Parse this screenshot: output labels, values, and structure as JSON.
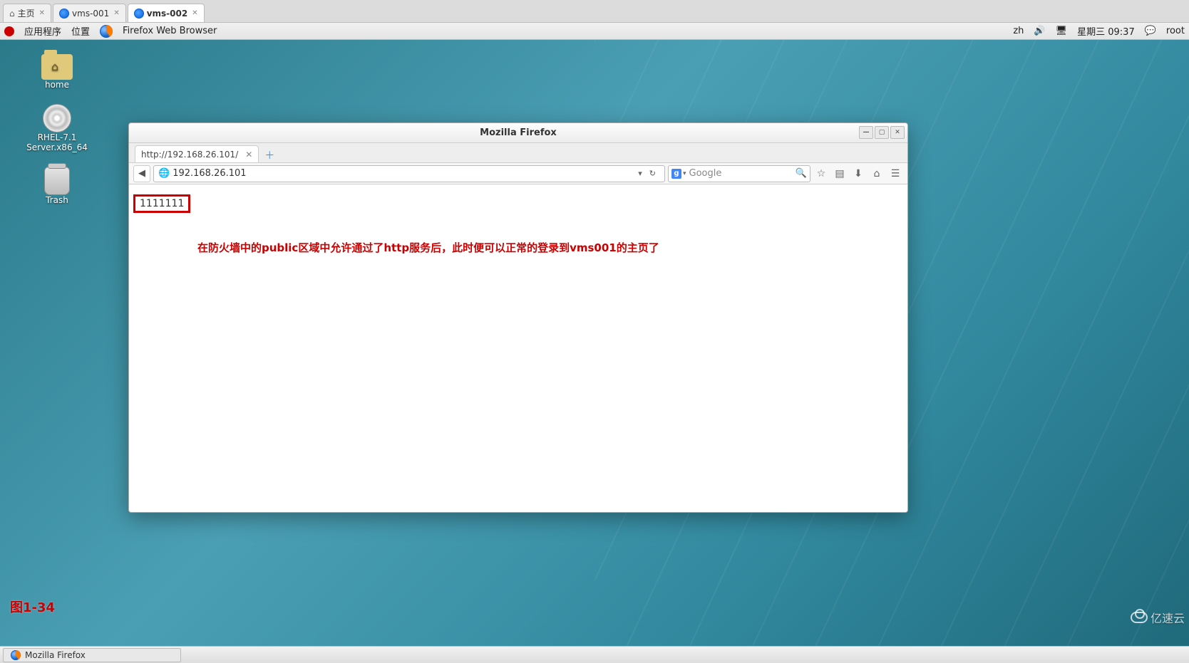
{
  "outer_tabs": [
    {
      "label": "主页",
      "active": false,
      "icon": "home"
    },
    {
      "label": "vms-001",
      "active": false,
      "icon": "firefox"
    },
    {
      "label": "vms-002",
      "active": true,
      "icon": "firefox"
    }
  ],
  "gnome_panel": {
    "applications": "应用程序",
    "places": "位置",
    "app_running": "Firefox Web Browser",
    "input_method": "zh",
    "date_time": "星期三 09:37",
    "user": "root"
  },
  "desktop_icons": {
    "home": "home",
    "disc": "RHEL-7.1 Server.x86_64",
    "trash": "Trash"
  },
  "firefox": {
    "window_title": "Mozilla Firefox",
    "tab_title": "http://192.168.26.101/",
    "url": "192.168.26.101",
    "search_placeholder": "Google",
    "page_body_text": "1111111",
    "annotation_text": "在防火墙中的public区域中允许通过了http服务后，此时便可以正常的登录到vms001的主页了"
  },
  "caption": "图1-34",
  "taskbar": {
    "item": "Mozilla Firefox"
  },
  "watermark": "亿速云"
}
